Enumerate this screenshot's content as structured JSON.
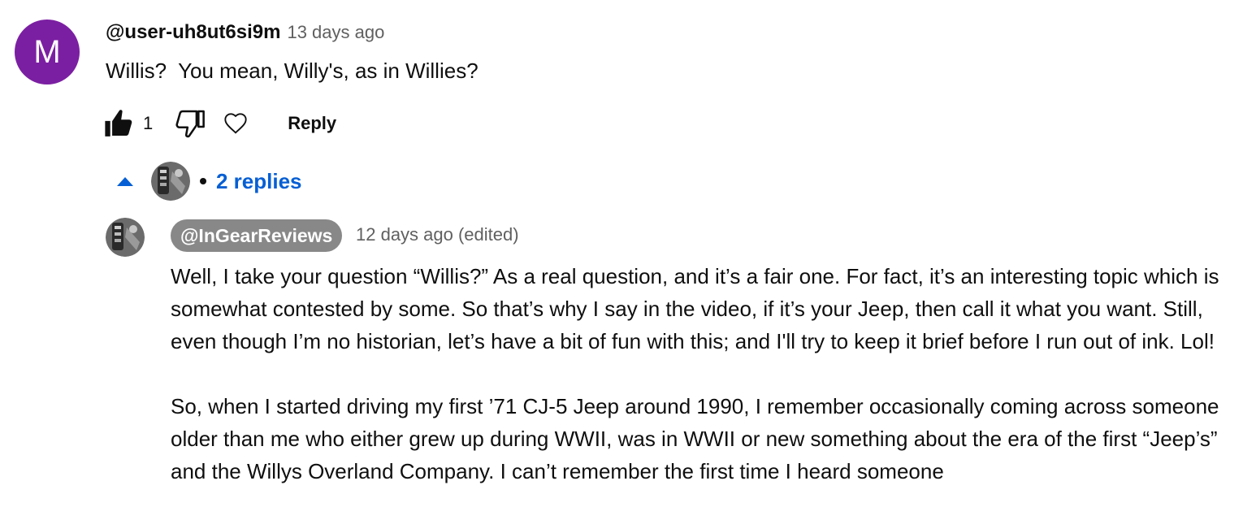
{
  "comment": {
    "avatar_letter": "M",
    "avatar_color": "#7b1fa2",
    "author": "@user-uh8ut6si9m",
    "time": "13 days ago",
    "text": "Willis?  You mean, Willy's, as in Willies?",
    "like_count": "1",
    "reply_label": "Reply"
  },
  "replies_toggle": {
    "label": "2 replies",
    "accent_color": "#065fd4"
  },
  "reply": {
    "author": "@InGearReviews",
    "time": "12 days ago (edited)",
    "paragraph_1": "Well, I take your question “Willis?” As a real question, and it’s a fair one.  For fact, it’s an interesting topic which is somewhat contested by some.  So that’s why I say in the video, if it’s your Jeep, then call it what you want.  Still, even though I’m no historian, let’s have a bit of fun with this; and I'll try to keep it brief before I run out of ink.  Lol!",
    "paragraph_2": "So, when I started driving my first ’71 CJ-5 Jeep around 1990, I remember occasionally coming across someone older than me who either grew up during WWII, was in WWII or new something about the era of the first “Jeep’s” and the Willys Overland Company.  I can’t remember the first time I heard someone"
  }
}
